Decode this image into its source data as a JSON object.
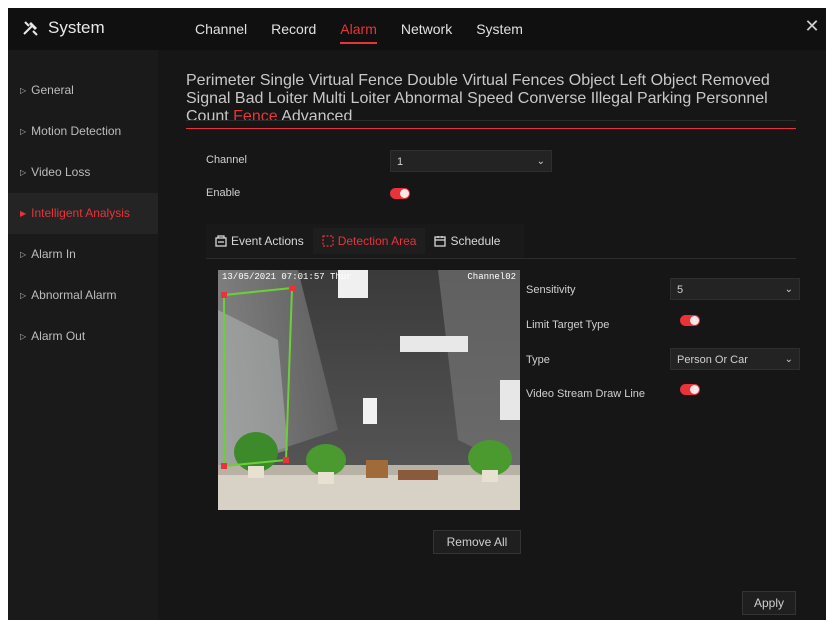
{
  "app": {
    "title": "System"
  },
  "topnav": [
    "Channel",
    "Record",
    "Alarm",
    "Network",
    "System"
  ],
  "topnav_active": "Alarm",
  "sidebar": {
    "items": [
      {
        "label": "General"
      },
      {
        "label": "Motion Detection"
      },
      {
        "label": "Video Loss"
      },
      {
        "label": "Intelligent Analysis"
      },
      {
        "label": "Alarm In"
      },
      {
        "label": "Abnormal Alarm"
      },
      {
        "label": "Alarm Out"
      }
    ],
    "active": "Intelligent Analysis"
  },
  "subtabs": {
    "row1": [
      "Perimeter",
      "Single Virtual Fence",
      "Double Virtual Fences",
      "Object Left",
      "Object Removed",
      "Signal Bad"
    ],
    "row2": [
      "Loiter",
      "Multi Loiter",
      "Abnormal Speed",
      "Converse",
      "Illegal Parking",
      "Personnel Count",
      "Fence",
      "Advanced"
    ],
    "active": "Fence"
  },
  "form": {
    "channel_label": "Channel",
    "channel_value": "1",
    "enable_label": "Enable",
    "enable_on": true
  },
  "tabs": [
    {
      "label": "Event Actions",
      "icon": "event-actions-icon"
    },
    {
      "label": "Detection Area",
      "icon": "detection-area-icon"
    },
    {
      "label": "Schedule",
      "icon": "calendar-icon"
    }
  ],
  "tabs_active": "Detection Area",
  "video": {
    "timestamp": "13/05/2021 07:01:57 Thur",
    "channel_label": "Channel02"
  },
  "settings": {
    "sensitivity_label": "Sensitivity",
    "sensitivity_value": "5",
    "limit_target_label": "Limit Target Type",
    "limit_target_on": true,
    "type_label": "Type",
    "type_value": "Person Or Car",
    "draw_line_label": "Video Stream Draw Line",
    "draw_line_on": true
  },
  "buttons": {
    "remove_all": "Remove All",
    "apply": "Apply"
  },
  "colors": {
    "accent": "#e8333a",
    "background": "#161616",
    "fence_line": "#6ccf3a",
    "fence_handle": "#e8333a"
  }
}
